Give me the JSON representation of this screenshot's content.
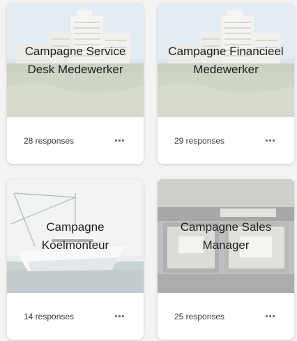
{
  "cards": [
    {
      "title": "Campagne Service Desk Medewerker",
      "responses": "28 responses",
      "cover": "building-coast-icon"
    },
    {
      "title": "Campagne Financieel Medewerker",
      "responses": "29 responses",
      "cover": "building-coast-icon"
    },
    {
      "title": "Campagne Koelmonteur",
      "responses": "14 responses",
      "cover": "boat-icon"
    },
    {
      "title": "Campagne Sales Manager",
      "responses": "25 responses",
      "cover": "storefront-icon"
    }
  ],
  "colors": {
    "page_bg": "#f3f3f3",
    "card_bg": "#ffffff",
    "title_text": "#1e1e1e",
    "meta_text": "#3b3b3b"
  }
}
